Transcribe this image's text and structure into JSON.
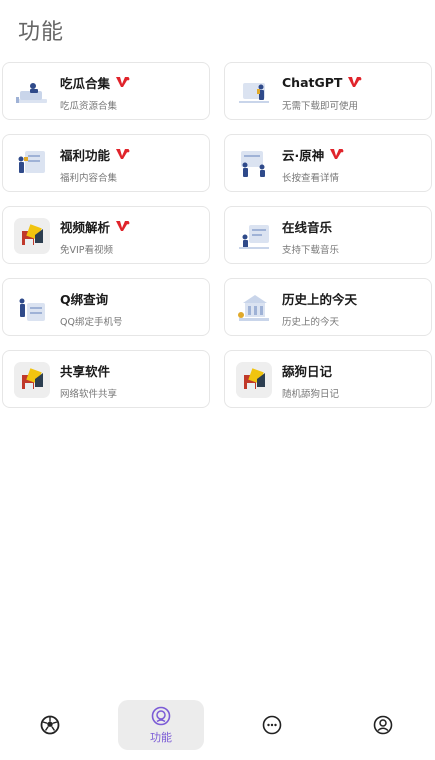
{
  "page": {
    "title": "功能"
  },
  "cards": [
    {
      "title": "吃瓜合集",
      "subtitle": "吃瓜资源合集",
      "vip": true,
      "icon": "sofa-person-illustration"
    },
    {
      "title": "ChatGPT",
      "subtitle": "无需下载即可使用",
      "vip": true,
      "icon": "chatgpt-person-illustration"
    },
    {
      "title": "福利功能",
      "subtitle": "福利内容合集",
      "vip": true,
      "icon": "welfare-person-illustration"
    },
    {
      "title": "云·原神",
      "subtitle": "长按查看详情",
      "vip": true,
      "icon": "genshin-person-illustration"
    },
    {
      "title": "视频解析",
      "subtitle": "免VIP看视频",
      "vip": true,
      "icon": "video-puzzle-icon"
    },
    {
      "title": "在线音乐",
      "subtitle": "支持下载音乐",
      "vip": false,
      "icon": "music-person-illustration"
    },
    {
      "title": "Q绑查询",
      "subtitle": "QQ绑定手机号",
      "vip": false,
      "icon": "qq-person-illustration"
    },
    {
      "title": "历史上的今天",
      "subtitle": "历史上的今天",
      "vip": false,
      "icon": "history-building-illustration"
    },
    {
      "title": "共享软件",
      "subtitle": "网络软件共享",
      "vip": false,
      "icon": "software-puzzle-icon"
    },
    {
      "title": "舔狗日记",
      "subtitle": "随机舔狗日记",
      "vip": false,
      "icon": "diary-puzzle-icon"
    }
  ],
  "nav": {
    "items": [
      {
        "icon": "soccer-ball-icon",
        "label": ""
      },
      {
        "icon": "face-circle-icon",
        "label": "功能",
        "active": true
      },
      {
        "icon": "more-dots-icon",
        "label": ""
      },
      {
        "icon": "user-circle-icon",
        "label": ""
      }
    ]
  },
  "colors": {
    "accent": "#7b5bd6",
    "vip_red": "#e0242b",
    "illustration_blue": "#2f4a8a",
    "illustration_light": "#dbe3f1"
  }
}
